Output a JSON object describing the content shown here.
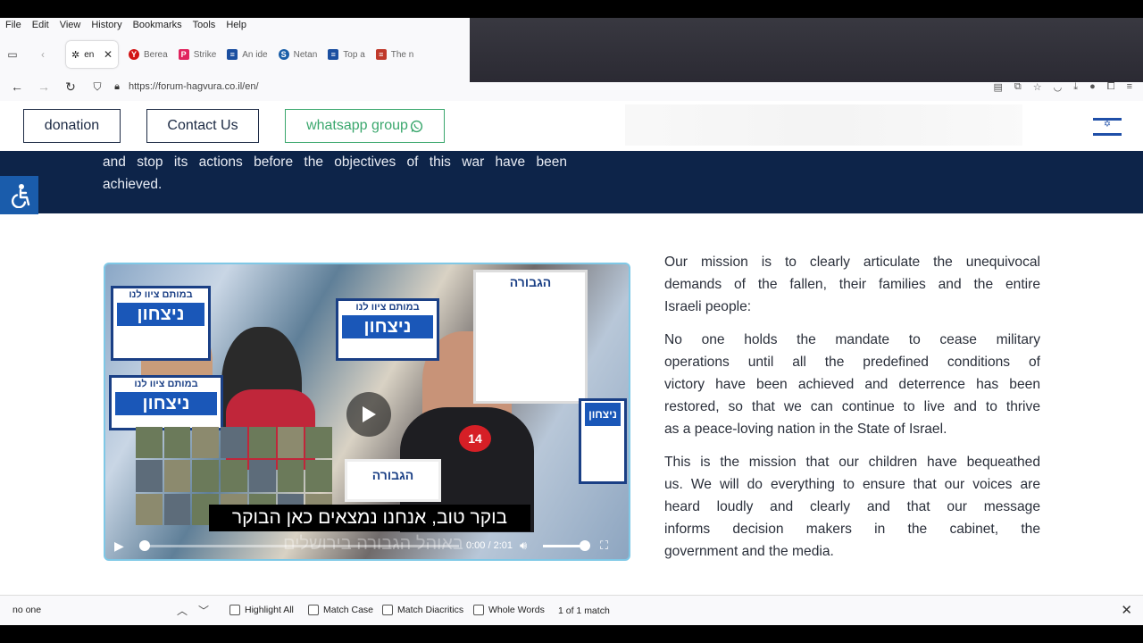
{
  "menubar": {
    "items": [
      "File",
      "Edit",
      "View",
      "History",
      "Bookmarks",
      "Tools",
      "Help"
    ]
  },
  "tabs": {
    "active": {
      "label": "en",
      "icon": "gear-icon"
    },
    "others": [
      {
        "label": "Berea",
        "color": "#d21515",
        "letter": "Y"
      },
      {
        "label": "Strike",
        "color": "#e0245e",
        "letter": "P"
      },
      {
        "label": "An ide",
        "color": "#1b4fa0",
        "letter": "≡"
      },
      {
        "label": "Netan",
        "color": "#1b5fa8",
        "letter": "S"
      },
      {
        "label": "Top a",
        "color": "#1b4fa0",
        "letter": "≡"
      },
      {
        "label": "The n",
        "color": "#c0392b",
        "letter": "≡"
      }
    ]
  },
  "navbar": {
    "url": "https://forum-hagvura.co.il/en/"
  },
  "header": {
    "donation": "donation",
    "contact": "Contact Us",
    "whatsapp": "whatsapp group"
  },
  "banner": {
    "line1": "and stop its actions before the objectives of this war have been",
    "line2": "achieved."
  },
  "video": {
    "caption": "בוקר טוב, אנחנו נמצאים כאן הבוקר",
    "caption_next": "באוהל הגבורה בירושלים",
    "time": "0:00 / 2:01",
    "sign_text_top": "במותם ציוו לנו",
    "sign_text_main": "ניצחון",
    "sign_logo": "הגבורה",
    "mic_badge": "14",
    "progress": 0.0,
    "volume": 1.0
  },
  "mission": {
    "p1": [
      "Our mission is to clearly articulate the unequivocal",
      "demands of the fallen, their families and the entire",
      "Israeli people:"
    ],
    "p2": [
      "No one holds the mandate to cease military",
      "operations until all the predefined conditions of",
      "victory have been achieved and deterrence has been",
      "restored, so that we can continue to live and to thrive",
      "as a peace-loving nation in the State of Israel."
    ],
    "p3": [
      "This is the mission that our children have bequeathed",
      "us. We will do everything to ensure that our voices are",
      "heard loudly and clearly and that our message",
      "informs decision makers in the cabinet, the",
      "government and the media."
    ]
  },
  "findbar": {
    "query": "no one",
    "highlight_all": "Highlight All",
    "match_case": "Match Case",
    "match_diacritics": "Match Diacritics",
    "whole_words": "Whole Words",
    "count": "1 of 1 match"
  },
  "colors": {
    "banner": "#0d2449",
    "whatsapp": "#3aa76d",
    "accessibility": "#1a5cab",
    "video_border": "#7fc8e6"
  }
}
